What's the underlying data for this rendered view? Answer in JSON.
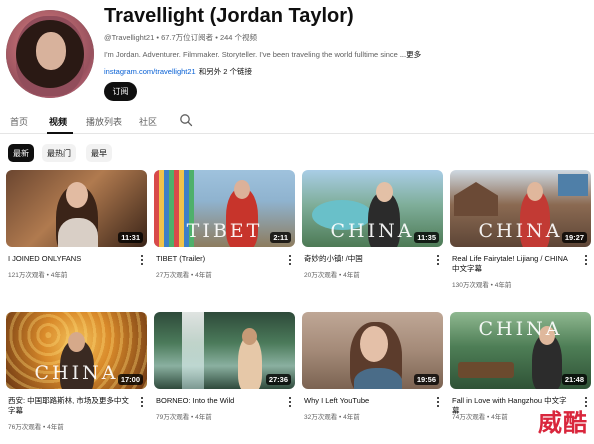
{
  "channel": {
    "name": "Travellight (Jordan Taylor)",
    "meta": "@Travellight21 • 67.7万位订阅者 • 244 个视频",
    "description": "I'm Jordan. Adventurer. Filmmaker. Storyteller. I've been traveling the world fulltime since",
    "more": "...更多",
    "link": "instagram.com/travellight21",
    "link_suffix": "和另外 2 个链接",
    "subscribe_label": "订阅"
  },
  "tabs": [
    {
      "label": "首页"
    },
    {
      "label": "视频"
    },
    {
      "label": "播放列表"
    },
    {
      "label": "社区"
    }
  ],
  "filters": [
    {
      "label": "最新"
    },
    {
      "label": "最热门"
    },
    {
      "label": "最早"
    }
  ],
  "videos": [
    {
      "title": "I JOINED ONLYFANS",
      "stats": "121万次观看 • 4年前",
      "duration": "11:31",
      "overlay": ""
    },
    {
      "title": "TIBET (Trailer)",
      "stats": "27万次观看 • 4年前",
      "duration": "2:11",
      "overlay": "TIBET"
    },
    {
      "title": "奇妙的小镇! /中国",
      "stats": "20万次观看 • 4年前",
      "duration": "11:35",
      "overlay": "CHINA"
    },
    {
      "title": "Real Life Fairytale! Lijiang / CHINA 中文字幕",
      "stats": "130万次观看 • 4年前",
      "duration": "19:27",
      "overlay": "CHINA"
    },
    {
      "title": "西安: 中国耶路斯林, 市场及更多中文字幕",
      "stats": "76万次观看 • 4年前",
      "duration": "17:00",
      "overlay": "CHINA"
    },
    {
      "title": "BORNEO: Into the Wild",
      "stats": "79万次观看 • 4年前",
      "duration": "27:36",
      "overlay": ""
    },
    {
      "title": "Why I Left YouTube",
      "stats": "32万次观看 • 4年前",
      "duration": "19:56",
      "overlay": ""
    },
    {
      "title": "Fall in Love with Hangzhou 中文字幕",
      "stats": "74万次观看 • 4年前",
      "duration": "21:48",
      "overlay": "CHINA"
    }
  ],
  "watermark": "威酷",
  "icons": {
    "search": "search-icon",
    "more": "more-vert-icon"
  }
}
